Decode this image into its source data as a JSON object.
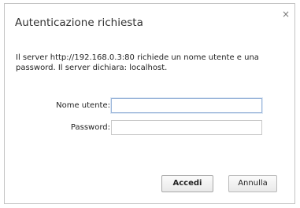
{
  "dialog": {
    "title": "Autenticazione richiesta",
    "close_icon": "close-icon",
    "close_glyph": "×",
    "message": "Il server http://192.168.0.3:80 richiede un nome utente e una password. Il server dichiara: localhost.",
    "username": {
      "label": "Nome utente:",
      "value": "",
      "placeholder": ""
    },
    "password": {
      "label": "Password:",
      "value": "",
      "placeholder": ""
    },
    "buttons": {
      "login": "Accedi",
      "cancel": "Annulla"
    }
  }
}
